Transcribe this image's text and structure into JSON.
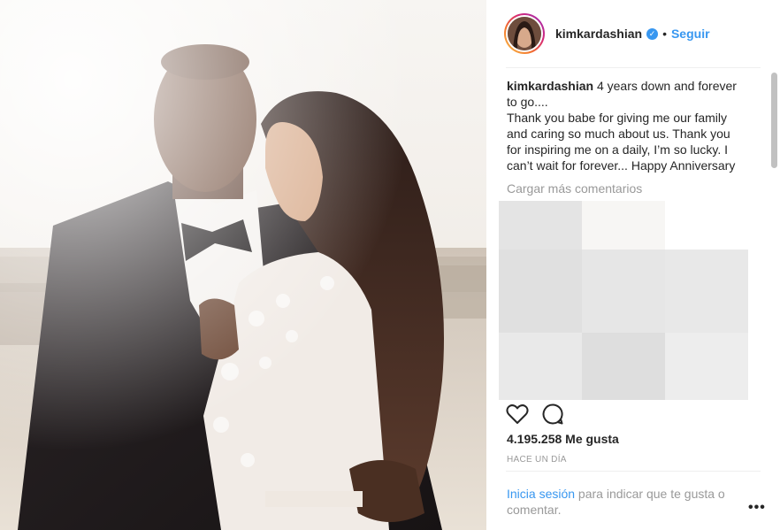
{
  "post": {
    "username": "kimkardashian",
    "verified_symbol": "✓",
    "separator": "•",
    "follow_label": "Seguir",
    "caption_lines": [
      "4 years down and forever",
      "to go....",
      "Thank you babe for giving me our family",
      "and caring so much about us. Thank you",
      "for inspiring me on a daily, I’m so lucky. I",
      "can’t wait for forever... Happy Anniversary"
    ],
    "load_more_label": "Cargar más comentarios",
    "likes_text": "4.195.258 Me gusta",
    "time_text": "HACE UN DÍA",
    "login_link_label": "Inicia sesión",
    "login_rest_label": " para indicar que te gusta o comentar.",
    "more_label": "•••"
  },
  "icons": {
    "like": "heart-outline-icon",
    "comment": "speech-bubble-icon",
    "verified": "verified-badge-icon"
  },
  "colors": {
    "accent": "#3897f0",
    "text": "#262626",
    "muted": "#999999",
    "divider": "#efefef"
  }
}
